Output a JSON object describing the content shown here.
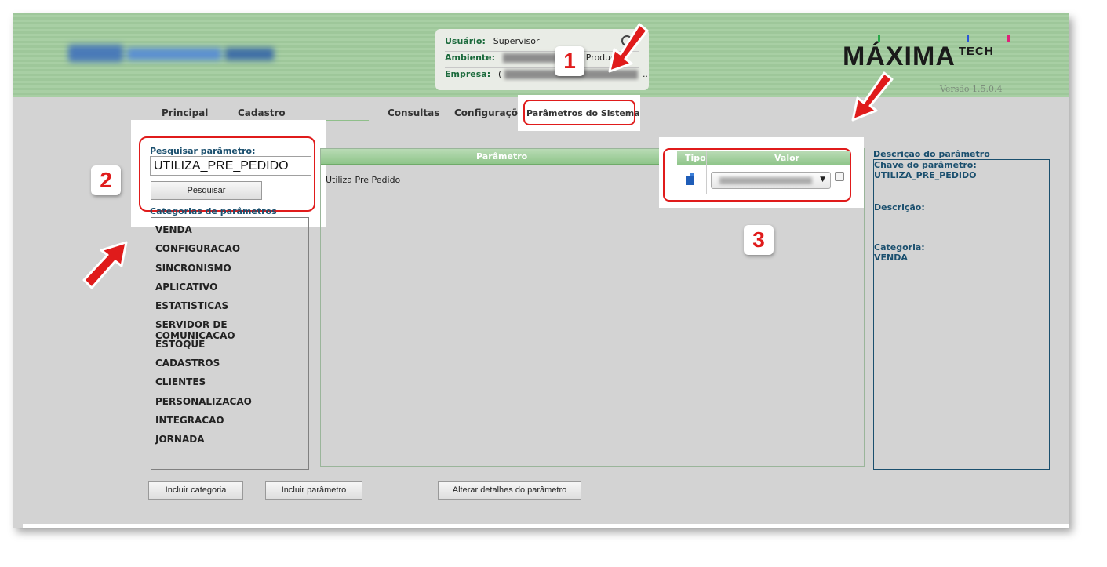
{
  "header": {
    "user_label": "Usuário:",
    "user_value": "Supervisor",
    "env_label": "Ambiente:",
    "env_value_suffix": "Produç",
    "company_label": "Empresa:",
    "company_value_prefix": "(",
    "company_value_suffix": "..",
    "brand": "MÁXIMA",
    "brand_suffix": "TECH",
    "version": "Versão 1.5.0.4",
    "brand_tick_colors": [
      "#2aa84a",
      "#2a55d8",
      "#e0227a"
    ]
  },
  "tabs": {
    "principal": "Principal",
    "cadastro": "Cadastro",
    "consultas": "Consultas",
    "configuracoes": "Configurações",
    "parametros": "Parâmetros do Sistema"
  },
  "search": {
    "label": "Pesquisar parâmetro:",
    "value": "UTILIZA_PRE_PEDIDO",
    "button": "Pesquisar"
  },
  "categories": {
    "label": "Categorias de parâmetros",
    "items": [
      "VENDA",
      "CONFIGURACAO",
      "SINCRONISMO",
      "APLICATIVO",
      "ESTATISTICAS",
      "SERVIDOR DE COMUNICACAO",
      "ESTOQUE",
      "CADASTROS",
      "CLIENTES",
      "PERSONALIZACAO",
      "INTEGRACAO",
      "JORNADA"
    ]
  },
  "grid": {
    "col_parametro": "Parâmetro",
    "col_tipo": "Tipo",
    "col_valor": "Valor",
    "rows": [
      {
        "parametro": "Utiliza Pre Pedido",
        "tipo_icon": "database-icon"
      }
    ]
  },
  "description": {
    "title": "Descrição do parâmetro",
    "key_label": "Chave do parâmetro:",
    "key_value": "UTILIZA_PRE_PEDIDO",
    "desc_label": "Descrição:",
    "category_label": "Categoria:",
    "category_value": "VENDA"
  },
  "buttons": {
    "add_category": "Incluir categoria",
    "add_parameter": "Incluir parâmetro",
    "edit_details": "Alterar detalhes do parâmetro"
  },
  "annotations": {
    "badge1": "1",
    "badge2": "2",
    "badge3": "3",
    "color": "#e01b1b"
  }
}
